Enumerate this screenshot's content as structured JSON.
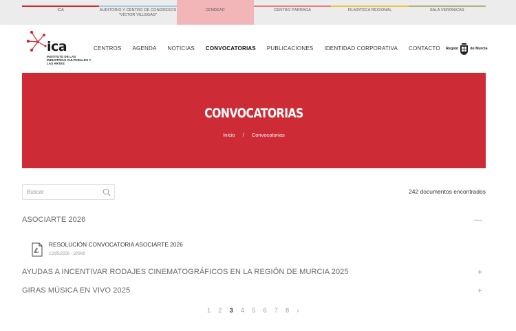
{
  "centers": [
    {
      "label": "ICA",
      "color": "#cd2c37",
      "active": false
    },
    {
      "label": "AUDITORIO Y CENTRO DE CONGRESOS \"VÍCTOR VILLEGAS\"",
      "color": "#a9c7e4",
      "active": false
    },
    {
      "label": "CENDEAC",
      "color": "#f2b6b9",
      "active": true
    },
    {
      "label": "CENTRO PÁRRAGA",
      "color": "#e8807a",
      "active": false
    },
    {
      "label": "FILMOTECA REGIONAL",
      "color": "#e8c64a",
      "active": false
    },
    {
      "label": "SALA VERÓNICAS",
      "color": "#b3b27a",
      "active": false
    }
  ],
  "logo": {
    "word": "ica",
    "subtitle": "INSTITUTO DE LAS INDUSTRIAS CULTURALES Y LAS ARTES",
    "accent": "#cd2c37"
  },
  "nav": {
    "items": [
      {
        "label": "CENTROS",
        "active": false
      },
      {
        "label": "AGENDA",
        "active": false
      },
      {
        "label": "NOTICIAS",
        "active": false
      },
      {
        "label": "CONVOCATORIAS",
        "active": true
      },
      {
        "label": "PUBLICACIONES",
        "active": false
      },
      {
        "label": "IDENTIDAD CORPORATIVA",
        "active": false
      },
      {
        "label": "CONTACTO",
        "active": false
      }
    ]
  },
  "region": {
    "left": "Región",
    "right": "de Murcia"
  },
  "banner": {
    "title": "CONVOCATORIAS",
    "breadcrumb": {
      "home": "Inicio",
      "separator": "/",
      "current": "Convocatorias"
    },
    "color": "#cd2c37"
  },
  "search": {
    "placeholder": "Buscar",
    "value": ""
  },
  "results": {
    "count_text": "242 documentos encontrados"
  },
  "sections": [
    {
      "title": "ASOCIARTE 2026",
      "toggle": "—",
      "expanded": true
    },
    {
      "title": "AYUDAS A INCENTIVAR RODAJES CINEMATOGRÁFICOS EN LA REGIÓN DE MURCIA 2025",
      "toggle": "+",
      "expanded": false
    },
    {
      "title": "GIRAS MÚSICA EN VIVO 2025",
      "toggle": "+",
      "expanded": false
    }
  ],
  "document": {
    "title": "RESOLUCIÓN CONVOCATORIA ASOCIARTE 2026",
    "meta": "12/05/2026 - 325Kb",
    "icon": "pdf-icon"
  },
  "pagination": {
    "pages": [
      "1",
      "2",
      "3",
      "4",
      "5",
      "6",
      "7",
      "8"
    ],
    "current": "3",
    "next": "›"
  }
}
